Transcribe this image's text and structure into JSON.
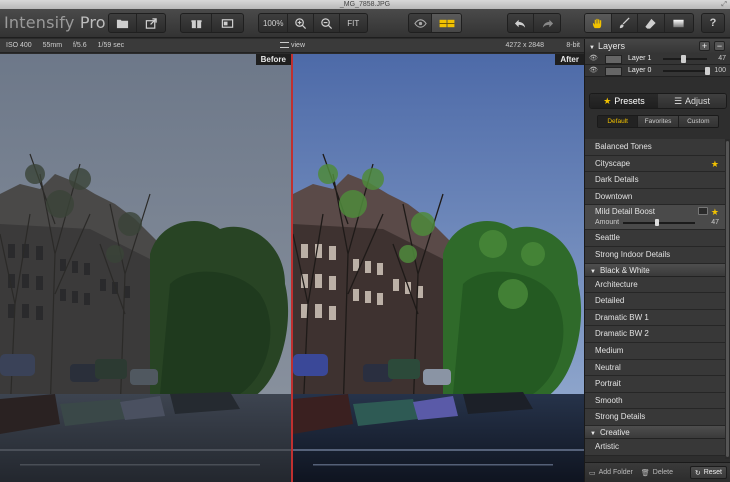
{
  "window": {
    "title": "_MG_7858.JPG",
    "resize_glyph": "⤢"
  },
  "app": {
    "name_light": "Intensify",
    "name_bold": " Pro"
  },
  "toolbar": {
    "zoom_100": "100%",
    "zoom_fit": "FIT"
  },
  "info": {
    "iso": "ISO 400",
    "focal": "55mm",
    "aperture": "f/5.6",
    "shutter": "1/59 sec",
    "view_label": "view",
    "dimensions": "4272 x 2848",
    "bitdepth": "8-bit"
  },
  "panes": {
    "before_label": "Before",
    "after_label": "After"
  },
  "layers": {
    "title": "Layers",
    "add_label": "+",
    "remove_label": "−",
    "items": [
      {
        "name": "Layer 1",
        "value": "47",
        "level": 0.47
      },
      {
        "name": "Layer 0",
        "value": "100",
        "level": 1.0
      }
    ]
  },
  "tabs": {
    "presets": "Presets",
    "adjust": "Adjust"
  },
  "subtabs": {
    "default": "Default",
    "favorites": "Favorites",
    "custom": "Custom"
  },
  "presets": {
    "group1": [
      {
        "name": "Balanced Tones",
        "fav": false
      },
      {
        "name": "Cityscape",
        "fav": true
      },
      {
        "name": "Dark Details",
        "fav": false
      },
      {
        "name": "Downtown",
        "fav": false
      }
    ],
    "selected": {
      "name": "Mild Detail Boost",
      "amount_label": "Amount",
      "amount_value": "47",
      "amount_level": 0.47
    },
    "group1b": [
      {
        "name": "Seattle"
      },
      {
        "name": "Strong Indoor Details"
      }
    ],
    "section_bw": "Black & White",
    "bw": [
      {
        "name": "Architecture"
      },
      {
        "name": "Detailed"
      },
      {
        "name": "Dramatic BW 1"
      },
      {
        "name": "Dramatic BW 2"
      },
      {
        "name": "Medium"
      },
      {
        "name": "Neutral"
      },
      {
        "name": "Portrait"
      },
      {
        "name": "Smooth"
      },
      {
        "name": "Strong Details"
      }
    ],
    "section_creative": "Creative",
    "creative": [
      {
        "name": "Artistic"
      }
    ]
  },
  "bottom": {
    "add_folder": "Add Folder",
    "delete": "Delete",
    "reset": "Reset"
  },
  "colors": {
    "accent": "#f2c200",
    "divider": "#c03030"
  }
}
